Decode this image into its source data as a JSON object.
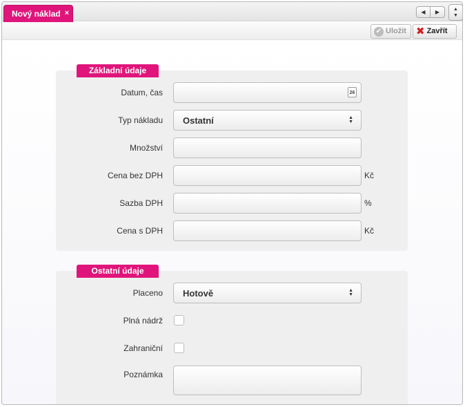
{
  "tab": {
    "title": "Nový náklad",
    "close": "×"
  },
  "nav": {
    "prev": "◀",
    "next": "▶",
    "up": "▲",
    "down": "▼"
  },
  "toolbar": {
    "save_label": "Uložit",
    "close_label": "Zavřít"
  },
  "sections": {
    "basic": {
      "title": "Základní údaje",
      "date_label": "Datum, čas",
      "date_value": "",
      "calendar_day": "26",
      "type_label": "Typ nákladu",
      "type_value": "Ostatní",
      "qty_label": "Množství",
      "price_label": "Cena bez DPH",
      "price_unit": "Kč",
      "vat_label": "Sazba DPH",
      "vat_unit": "%",
      "price_vat_label": "Cena s DPH",
      "price_vat_unit": "Kč"
    },
    "other": {
      "title": "Ostatní údaje",
      "paid_label": "Placeno",
      "paid_value": "Hotově",
      "full_tank_label": "Plná nádrž",
      "foreign_label": "Zahraniční",
      "note_label": "Poznámka"
    }
  }
}
